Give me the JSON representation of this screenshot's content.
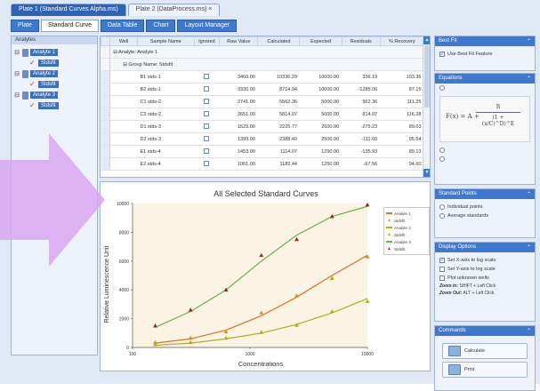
{
  "doc_tabs": [
    "Plate 1 (Standard Curves Alpha.ms)",
    "Plate 2 (DataProcess.ms)",
    "×"
  ],
  "sub_tabs": [
    "Plate",
    "Standard Curve",
    "Data Table",
    "Chart",
    "Layout Manager"
  ],
  "left_panel": {
    "header": "Analytes",
    "items": [
      {
        "label": "Analyte 1",
        "child": "Stdsfit"
      },
      {
        "label": "Analyte 2",
        "child": "Stdsfit"
      },
      {
        "label": "Analyte 3",
        "child": "Stdsfit"
      }
    ]
  },
  "grid": {
    "headers": [
      "",
      "Well",
      "Sample Name",
      "Ignored",
      "Raw Value",
      "Calculated",
      "Expected",
      "Residuals",
      "% Recovery"
    ],
    "group1": "Analyte: Analyte 1",
    "group2": "Group Name: Stdsfit",
    "rows": [
      [
        "B1 stds-1",
        "3460.00",
        "10336.29",
        "10000.00",
        "336.19",
        "103.36"
      ],
      [
        "B2 stds-1",
        "3330.00",
        "8714.94",
        "10000.00",
        "-1285.06",
        "87.15"
      ],
      [
        "C1 stds-2",
        "2741.00",
        "5562.36",
        "5000.00",
        "562.36",
        "111.25"
      ],
      [
        "C2 stds-2",
        "2651.00",
        "5814.07",
        "5000.00",
        "814.07",
        "116.28"
      ],
      [
        "D1 stds-3",
        "1523.00",
        "2225.77",
        "2500.00",
        "-275.23",
        "89.03"
      ],
      [
        "D2 stds-3",
        "1399.00",
        "2388.40",
        "2500.00",
        "-111.60",
        "95.54"
      ],
      [
        "E1 stds-4",
        "1453.00",
        "1114.07",
        "1250.00",
        "-135.93",
        "89.13"
      ],
      [
        "E2 stds-4",
        "1061.00",
        "1182.44",
        "1250.00",
        "-67.56",
        "94.60"
      ]
    ]
  },
  "chart_data": {
    "type": "line",
    "title": "All Selected Standard Curves",
    "xlabel": "Concentrations",
    "ylabel": "Relative Luminescence Unit",
    "x_scale": "log",
    "xlim": [
      100,
      10000
    ],
    "ylim": [
      0,
      10000
    ],
    "xticks": [
      "100",
      "1000",
      "10000"
    ],
    "yticks": [
      "0",
      "2000",
      "4000",
      "6000",
      "8000",
      "10000"
    ],
    "grid": false,
    "legend_position": "right",
    "series": [
      {
        "name": "Analyte 1",
        "role": "fit",
        "color": "#e07020",
        "x": [
          156,
          312,
          625,
          1250,
          2500,
          5000,
          10000
        ],
        "y": [
          300,
          600,
          1200,
          2200,
          3500,
          5000,
          6400
        ]
      },
      {
        "name": "Stdsfit",
        "role": "points",
        "color": "#c7962a",
        "x": [
          156,
          312,
          625,
          1250,
          2500,
          5000,
          10000
        ],
        "y": [
          350,
          650,
          1100,
          2400,
          3600,
          4800,
          6300
        ]
      },
      {
        "name": "Analyte 2",
        "role": "fit",
        "color": "#a8b020",
        "x": [
          156,
          312,
          625,
          1250,
          2500,
          5000,
          10000
        ],
        "y": [
          150,
          300,
          600,
          1000,
          1600,
          2400,
          3400
        ]
      },
      {
        "name": "Stdsfit",
        "role": "points",
        "color": "#a8b020",
        "x": [
          156,
          312,
          625,
          1250,
          2500,
          5000,
          10000
        ],
        "y": [
          200,
          350,
          650,
          1050,
          1550,
          2500,
          3200
        ]
      },
      {
        "name": "Analyte 3",
        "role": "fit",
        "color": "#6ab04c",
        "x": [
          156,
          312,
          625,
          1250,
          2500,
          5000,
          10000
        ],
        "y": [
          1400,
          2500,
          4000,
          6000,
          7800,
          9100,
          9800
        ]
      },
      {
        "name": "Stdsfit",
        "role": "points",
        "color": "#8b2a1a",
        "x": [
          156,
          312,
          625,
          1250,
          2500,
          5000,
          10000
        ],
        "y": [
          1500,
          2600,
          4000,
          6400,
          7500,
          9100,
          9900
        ]
      }
    ]
  },
  "right_panel": {
    "best_fit_header": "Best Fit",
    "best_fit_option": "Use Best Fit Feature",
    "equation_header": "Equations",
    "equation_lhs": "F(x) = A +",
    "equation_num": "B",
    "equation_den": "(1 + (x/C)^D)^E",
    "standard_points_header": "Standard Points",
    "standard_points_options": [
      "Individual points",
      "Average standards"
    ],
    "display_options_header": "Display Options",
    "display_options": [
      "Set X-axis to log scale",
      "Set Y-axis to log scale",
      "Plot unknown wells"
    ],
    "zoom_in": "Zoom In:",
    "zoom_in_value": "SHIFT + Left Click",
    "zoom_out": "Zoom Out:",
    "zoom_out_value": "ALT + Left Click",
    "commands_header": "Commands",
    "calculate_label": "Calculate",
    "print_label": "Print"
  },
  "colors": {
    "accent": "#3e78cf",
    "arrow": "#d9a6f0"
  }
}
